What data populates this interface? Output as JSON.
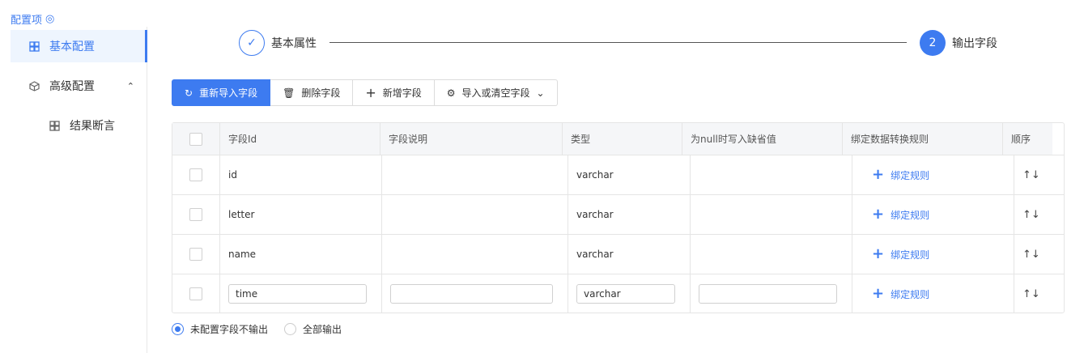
{
  "sidebar": {
    "title": "配置项",
    "items": [
      {
        "label": "基本配置"
      },
      {
        "label": "高级配置"
      },
      {
        "label": "结果断言"
      }
    ]
  },
  "steps": [
    {
      "label": "基本属性",
      "num": ""
    },
    {
      "label": "输出字段",
      "num": "2"
    }
  ],
  "toolbar": {
    "reimport": "重新导入字段",
    "delete": "删除字段",
    "add": "新增字段",
    "import_clear": "导入或清空字段"
  },
  "table": {
    "headers": [
      "字段Id",
      "字段说明",
      "类型",
      "为null时写入缺省值",
      "绑定数据转换规则",
      "顺序"
    ],
    "rows": [
      {
        "id": "id",
        "type": "varchar"
      },
      {
        "id": "letter",
        "type": "varchar"
      },
      {
        "id": "name",
        "type": "varchar"
      },
      {
        "id": "time",
        "type": "varchar"
      }
    ],
    "bind_rule": "绑定规则",
    "order": "↑↓"
  },
  "output": {
    "opt1": "未配置字段不输出",
    "opt2": "全部输出",
    "selected": "opt1"
  },
  "colors": {
    "accent": "#3d7bf0"
  }
}
